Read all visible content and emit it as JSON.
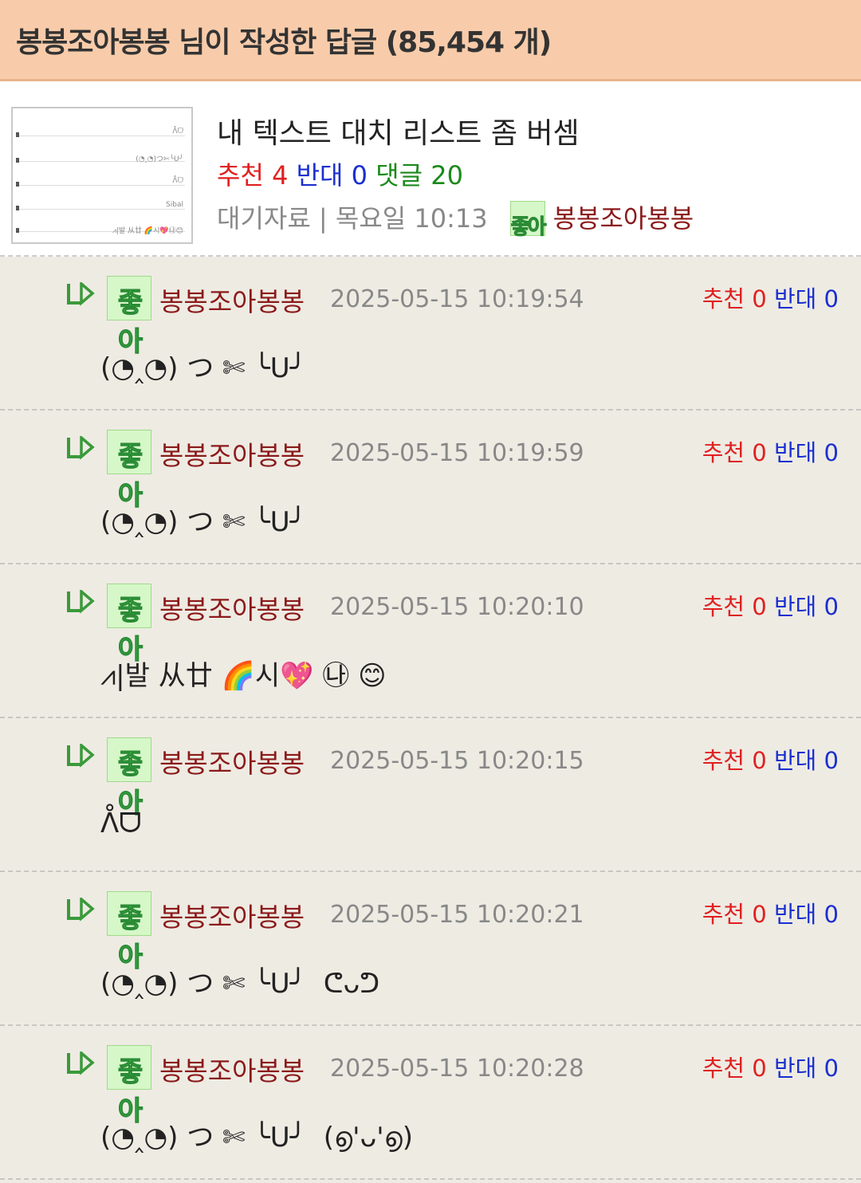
{
  "header": {
    "title": "봉봉조아봉봉 님이 작성한 답글 (85,454 개)"
  },
  "post": {
    "title": "내 텍스트 대치 리스트 좀 버셈",
    "rec_label": "추천",
    "rec_count": "4",
    "opp_label": "반대",
    "opp_count": "0",
    "cmt_label": "댓글",
    "cmt_count": "20",
    "meta": "대기자료 | 목요일 10:13",
    "badge_text": "좋아",
    "author": "봉봉조아봉봉"
  },
  "comments": [
    {
      "author": "봉봉조아봉봉",
      "date": "2025-05-15 10:19:54",
      "rec_label": "추천",
      "rec": "0",
      "opp_label": "반대",
      "opp": "0",
      "body": "(◔‸◔) つ ✄ ╰U╯"
    },
    {
      "author": "봉봉조아봉봉",
      "date": "2025-05-15 10:19:59",
      "rec_label": "추천",
      "rec": "0",
      "opp_label": "반대",
      "opp": "0",
      "body": "(◔‸◔) つ ✄ ╰U╯"
    },
    {
      "author": "봉봉조아봉봉",
      "date": "2025-05-15 10:20:10",
      "rec_label": "추천",
      "rec": "0",
      "opp_label": "반대",
      "opp": "0",
      "body": "⩘|발 从廿 🌈시💖 ㉯ 😊"
    },
    {
      "author": "봉봉조아봉봉",
      "date": "2025-05-15 10:20:15",
      "rec_label": "추천",
      "rec": "0",
      "opp_label": "반대",
      "opp": "0",
      "body": "ᐰᗜ"
    },
    {
      "author": "봉봉조아봉봉",
      "date": "2025-05-15 10:20:21",
      "rec_label": "추천",
      "rec": "0",
      "opp_label": "반대",
      "opp": "0",
      "body": "(◔‸◔) つ ✄ ╰U╯  ᕦᴗᕤ"
    },
    {
      "author": "봉봉조아봉봉",
      "date": "2025-05-15 10:20:28",
      "rec_label": "추천",
      "rec": "0",
      "opp_label": "반대",
      "opp": "0",
      "body": "(◔‸◔) つ ✄ ╰U╯  (൭'ᴗ'൭)"
    }
  ]
}
